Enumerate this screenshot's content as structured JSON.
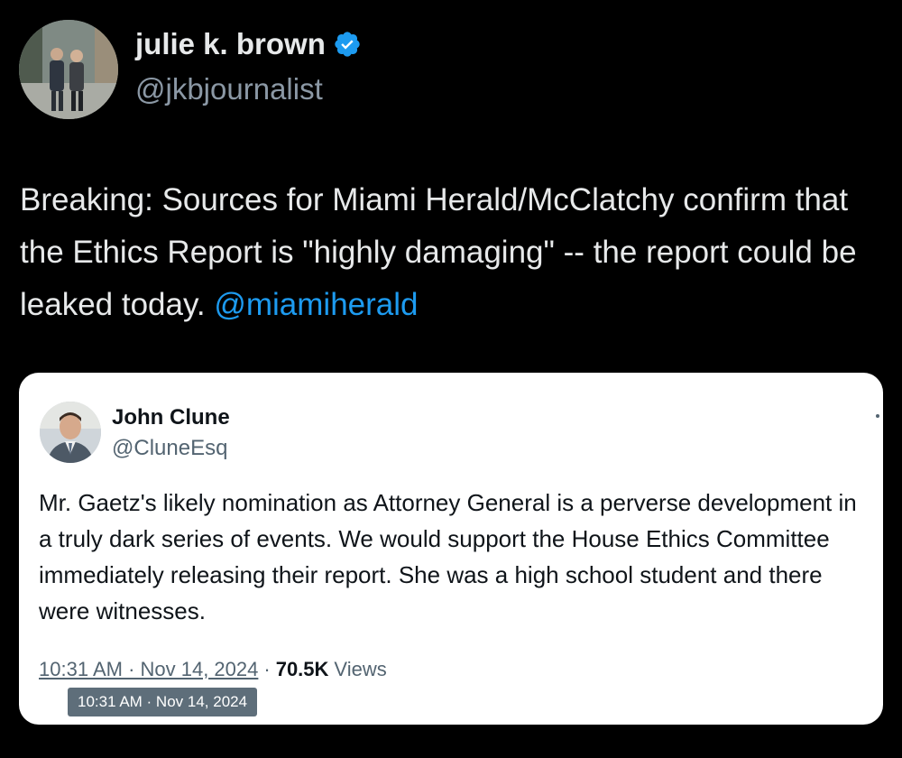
{
  "author": {
    "display_name": "julie k. brown",
    "handle": "@jkbjournalist",
    "verified_icon": "verified-badge-icon",
    "verified_color": "#1d9bf0"
  },
  "tweet": {
    "text": "Breaking: Sources for Miami Herald/McClatchy confirm that the Ethics Report is \"highly damaging\" -- the report could be leaked today. ",
    "mention": "@miamiherald",
    "mention_color": "#1d9bf0"
  },
  "quoted": {
    "display_name": "John Clune",
    "handle": "@CluneEsq",
    "text": "Mr. Gaetz's likely nomination as Attorney General is a perverse development in a truly dark series of events. We would support the House Ethics Committee immediately releasing their report. She was a high school student and there were witnesses.",
    "timestamp": "10:31 AM · Nov 14, 2024",
    "separator": "·",
    "views_count": "70.5K",
    "views_label": "Views",
    "tooltip": "10:31 AM · Nov 14, 2024"
  },
  "colors": {
    "background": "#000000",
    "card_background": "#ffffff",
    "secondary_text": "#8b98a5"
  }
}
